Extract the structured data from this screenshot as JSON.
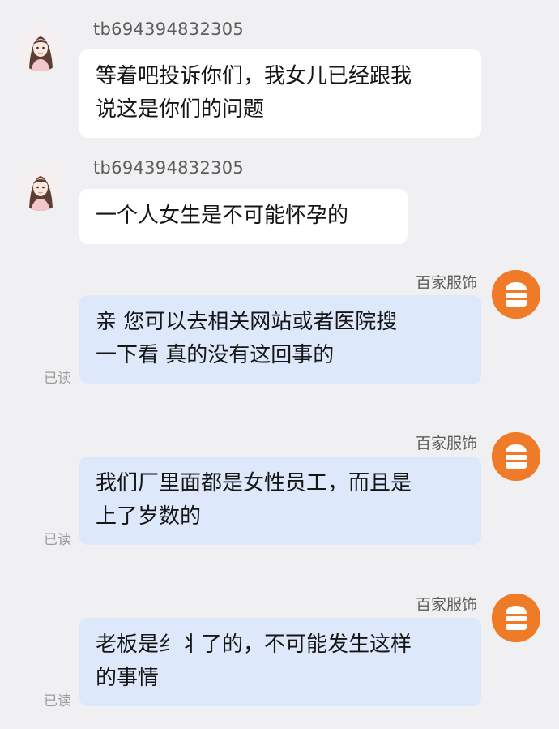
{
  "messages": [
    {
      "side": "left",
      "sender": "tb694394832305",
      "text": "等着吧投诉你们，我女儿已经跟我\n说这是你们的问题",
      "avatar_icon": "female-avatar-icon"
    },
    {
      "side": "left",
      "sender": "tb694394832305",
      "text": "一个人女生是不可能怀孕的",
      "avatar_icon": "female-avatar-icon"
    },
    {
      "side": "right",
      "sender": "百家服饰",
      "text": "亲 您可以去相关网站或者医院搜\n一下看 真的没有这回事的",
      "status": "已读",
      "avatar_icon": "store-icon"
    },
    {
      "side": "right",
      "sender": "百家服饰",
      "text": "我们厂里面都是女性员工，而且是\n上了岁数的",
      "status": "已读",
      "avatar_icon": "store-icon"
    },
    {
      "side": "right",
      "sender": "百家服饰",
      "text": "老板是纟丬了的，不可能发生这样\n的事情",
      "status": "已读",
      "avatar_icon": "store-icon"
    }
  ],
  "colors": {
    "background": "#f0f0f2",
    "incoming_bubble": "#ffffff",
    "outgoing_bubble": "#dde9fb",
    "store_avatar": "#ef7a28",
    "sender_name": "#5c5c5c",
    "read_status": "#9b9b9b"
  }
}
